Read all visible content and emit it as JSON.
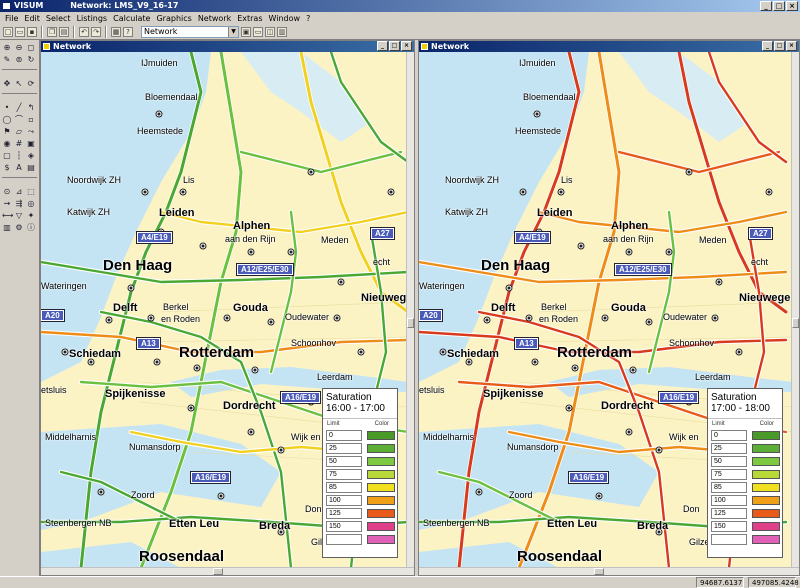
{
  "app": {
    "name": "VISUM",
    "window_title": "Network: LMS_V9_16-17"
  },
  "menu": [
    "File",
    "Edit",
    "Select",
    "Listings",
    "Calculate",
    "Graphics",
    "Network",
    "Extras",
    "Window",
    "?"
  ],
  "toolbar": {
    "combo_value": "Network"
  },
  "window_buttons": {
    "minimize": "_",
    "maximize": "□",
    "close": "×"
  },
  "maps": [
    {
      "title": "Network",
      "legend": {
        "title": "Saturation",
        "period": "16:00 - 17:00",
        "col_limit": "Limit",
        "col_color": "Color",
        "rows": [
          {
            "limit": "0",
            "color": "#4a9a2a"
          },
          {
            "limit": "25",
            "color": "#5cae36"
          },
          {
            "limit": "50",
            "color": "#7cc840"
          },
          {
            "limit": "75",
            "color": "#b8d838"
          },
          {
            "limit": "85",
            "color": "#f0e020"
          },
          {
            "limit": "100",
            "color": "#f0a018"
          },
          {
            "limit": "125",
            "color": "#e85a1a"
          },
          {
            "limit": "150",
            "color": "#e0408a"
          },
          {
            "limit": "",
            "color": "#e060b8"
          }
        ]
      }
    },
    {
      "title": "Network",
      "legend": {
        "title": "Saturation",
        "period": "17:00 - 18:00",
        "col_limit": "Limit",
        "col_color": "Color",
        "rows": [
          {
            "limit": "0",
            "color": "#4a9a2a"
          },
          {
            "limit": "25",
            "color": "#5cae36"
          },
          {
            "limit": "50",
            "color": "#7cc840"
          },
          {
            "limit": "75",
            "color": "#b8d838"
          },
          {
            "limit": "85",
            "color": "#f0e020"
          },
          {
            "limit": "100",
            "color": "#f0a018"
          },
          {
            "limit": "125",
            "color": "#e85a1a"
          },
          {
            "limit": "150",
            "color": "#e0408a"
          },
          {
            "limit": "",
            "color": "#e060b8"
          }
        ]
      }
    }
  ],
  "places": {
    "ijmuiden": "IJmuiden",
    "bloemendaal": "Bloemendaal",
    "heemstede": "Heemstede",
    "noordwijk": "Noordwijk ZH",
    "lisse": "Lis",
    "katwijk": "Katwijk ZH",
    "leiden": "Leiden",
    "alphen": "Alphen",
    "alphen2": "aan den Rijn",
    "denhaag": "Den Haag",
    "wateringen": "Wateringen",
    "delft": "Delft",
    "berkel": "Berkel",
    "rodenrijs": "en Roden",
    "gouda": "Gouda",
    "oudewater": "Oudewater",
    "nieuwegein": "Nieuwege",
    "schoonhoven": "Schoonhov",
    "schiedam": "Schiedam",
    "rotterdam": "Rotterdam",
    "leerdam": "Leerdam",
    "hellevoetsluis": "etsluis",
    "spijkenisse": "Spijkenisse",
    "dordrecht": "Dordrecht",
    "middelharnis": "Middelharnis",
    "numansdorp": "Numansdorp",
    "lijnkeniss": "Wijk en",
    "steenbergen": "Steenbergen NB",
    "ettenleur": "Etten Leu",
    "breda": "Breda",
    "roosendaal": "Roosendaal",
    "gilze": "Gilze",
    "dongen": "Don",
    "zevenbergen": "Zoord",
    "utrecht": "echt",
    "meppel": "Meden"
  },
  "shields": {
    "a4": "A4/E19",
    "a12": "A12/E25/E30",
    "a13": "A13",
    "a20": "A20",
    "a16": "A16/E19",
    "a27": "A27"
  },
  "status": {
    "x": "94687.6137",
    "y": "497085.4248"
  },
  "colors": {
    "background": "#fbf3c4",
    "water": "#c4e4f4",
    "green": "#4aa832",
    "yellow": "#f2d020",
    "orange": "#ee8c18",
    "red": "#d83a1c"
  }
}
